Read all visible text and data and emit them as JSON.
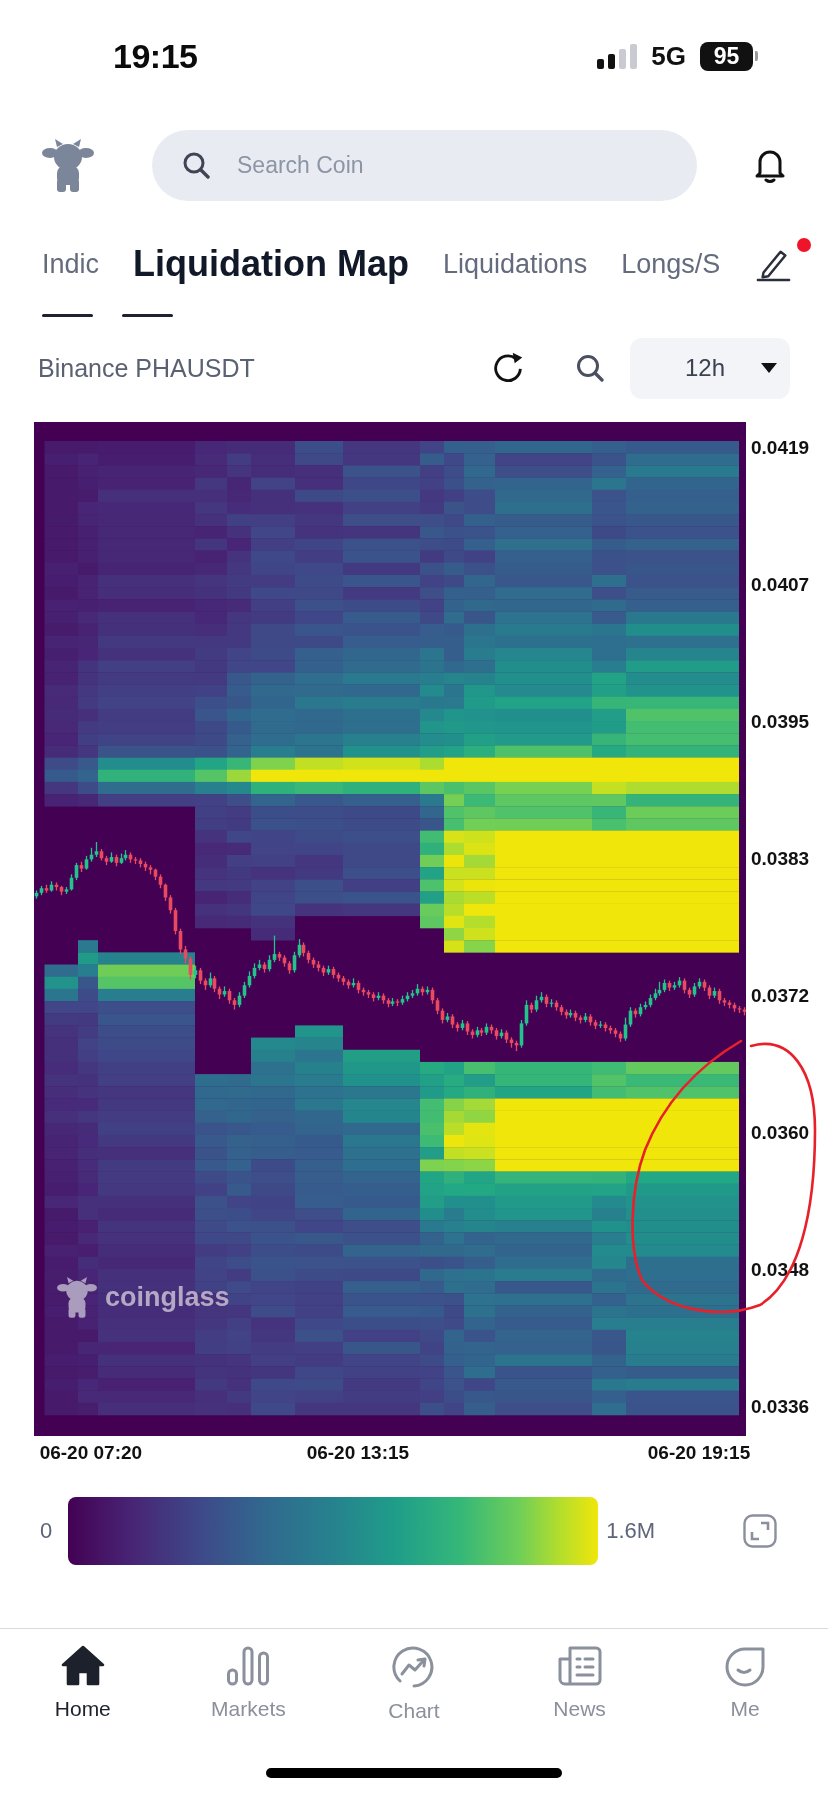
{
  "status_bar": {
    "time": "19:15",
    "network": "5G",
    "battery": "95"
  },
  "header": {
    "search": {
      "placeholder": "Search Coin"
    }
  },
  "tabs": [
    {
      "label": "Indic",
      "selected": false
    },
    {
      "label": "Liquidation Map",
      "selected": true
    },
    {
      "label": "Liquidations",
      "selected": false
    },
    {
      "label": "Longs/S",
      "selected": false
    }
  ],
  "tab_editor": {
    "badge": true
  },
  "toolbar": {
    "pair": "Binance PHAUSDT",
    "interval": "12h"
  },
  "chart": {
    "watermark": "coinglass",
    "chart_data": {
      "type": "candlestick",
      "ylim": [
        0.033349,
        0.042125
      ],
      "yticks": [
        {
          "value": 0.0419,
          "label": "0.0419"
        },
        {
          "value": 0.040714,
          "label": "0.0407"
        },
        {
          "value": 0.039529,
          "label": "0.0395"
        },
        {
          "value": 0.038343,
          "label": "0.0383"
        },
        {
          "value": 0.037157,
          "label": "0.0372"
        },
        {
          "value": 0.035971,
          "label": "0.0360"
        },
        {
          "value": 0.034786,
          "label": "0.0348"
        },
        {
          "value": 0.0336,
          "label": "0.0336"
        }
      ],
      "categories": [
        null,
        null,
        null,
        null,
        null,
        null,
        null,
        null,
        null,
        null,
        null,
        "06-20 07:20",
        null,
        null,
        null,
        null,
        null,
        null,
        null,
        null,
        null,
        null,
        null,
        null,
        null,
        null,
        null,
        null,
        null,
        null,
        null,
        null,
        null,
        null,
        null,
        null,
        null,
        null,
        null,
        null,
        null,
        null,
        null,
        null,
        null,
        null,
        null,
        null,
        null,
        null,
        null,
        null,
        null,
        null,
        null,
        null,
        null,
        null,
        null,
        null,
        null,
        null,
        null,
        null,
        null,
        "06-20 13:15",
        null,
        null,
        null,
        null,
        null,
        null,
        null,
        null,
        null,
        null,
        null,
        null,
        null,
        null,
        null,
        null,
        null,
        null,
        null,
        null,
        null,
        null,
        null,
        null,
        null,
        null,
        null,
        null,
        null,
        null,
        null,
        null,
        null,
        null,
        null,
        null,
        null,
        null,
        null,
        null,
        null,
        null,
        null,
        null,
        null,
        null,
        null,
        null,
        null,
        null,
        null,
        null,
        null,
        null,
        null,
        null,
        null,
        null,
        null,
        null,
        null,
        null,
        null,
        null,
        null,
        null,
        null,
        null,
        "06-20 19:15",
        null,
        null,
        null,
        null,
        null,
        null,
        null,
        null,
        null
      ],
      "ohlc": [
        [
          0.03802,
          0.03807,
          0.038,
          0.03805
        ],
        [
          0.03805,
          0.03811,
          0.03803,
          0.03809
        ],
        [
          0.03809,
          0.03812,
          0.03805,
          0.03807
        ],
        [
          0.03807,
          0.03815,
          0.03806,
          0.03812
        ],
        [
          0.03812,
          0.03814,
          0.03807,
          0.0381
        ],
        [
          0.0381,
          0.03811,
          0.03803,
          0.03806
        ],
        [
          0.03806,
          0.0381,
          0.03804,
          0.03808
        ],
        [
          0.03808,
          0.03821,
          0.03807,
          0.03818
        ],
        [
          0.03818,
          0.03831,
          0.03816,
          0.03829
        ],
        [
          0.03829,
          0.03832,
          0.03823,
          0.03826
        ],
        [
          0.03826,
          0.03837,
          0.03825,
          0.03834
        ],
        [
          0.03834,
          0.03844,
          0.03832,
          0.03838
        ],
        [
          0.03838,
          0.03849,
          0.03836,
          0.03841
        ],
        [
          0.03841,
          0.03843,
          0.03833,
          0.03835
        ],
        [
          0.03835,
          0.03837,
          0.03829,
          0.03832
        ],
        [
          0.03832,
          0.0384,
          0.03831,
          0.03836
        ],
        [
          0.03836,
          0.03838,
          0.03828,
          0.03831
        ],
        [
          0.03831,
          0.03839,
          0.0383,
          0.03835
        ],
        [
          0.03835,
          0.03842,
          0.03833,
          0.03838
        ],
        [
          0.03838,
          0.0384,
          0.03831,
          0.03834
        ],
        [
          0.03834,
          0.03836,
          0.0383,
          0.03833
        ],
        [
          0.03833,
          0.03835,
          0.03827,
          0.0383
        ],
        [
          0.0383,
          0.03832,
          0.03824,
          0.03827
        ],
        [
          0.03827,
          0.03829,
          0.03821,
          0.03825
        ],
        [
          0.03825,
          0.03826,
          0.03816,
          0.03819
        ],
        [
          0.03819,
          0.03821,
          0.03809,
          0.03812
        ],
        [
          0.03812,
          0.03813,
          0.03798,
          0.03801
        ],
        [
          0.03801,
          0.03803,
          0.03787,
          0.0379
        ],
        [
          0.0379,
          0.03792,
          0.03769,
          0.03772
        ],
        [
          0.03772,
          0.03774,
          0.03752,
          0.03756
        ],
        [
          0.03756,
          0.03759,
          0.03744,
          0.03748
        ],
        [
          0.03748,
          0.0375,
          0.0373,
          0.03734
        ],
        [
          0.03734,
          0.03742,
          0.03731,
          0.03738
        ],
        [
          0.03738,
          0.0374,
          0.03726,
          0.03729
        ],
        [
          0.03729,
          0.03731,
          0.03721,
          0.03725
        ],
        [
          0.03725,
          0.03736,
          0.03723,
          0.03731
        ],
        [
          0.03731,
          0.03733,
          0.03719,
          0.03722
        ],
        [
          0.03722,
          0.03724,
          0.03713,
          0.03717
        ],
        [
          0.03717,
          0.03724,
          0.03715,
          0.0372
        ],
        [
          0.0372,
          0.03722,
          0.03709,
          0.03712
        ],
        [
          0.03712,
          0.03714,
          0.03704,
          0.03708
        ],
        [
          0.03708,
          0.03719,
          0.03706,
          0.03716
        ],
        [
          0.03716,
          0.03728,
          0.03714,
          0.03725
        ],
        [
          0.03725,
          0.03737,
          0.03723,
          0.03733
        ],
        [
          0.03733,
          0.03744,
          0.03731,
          0.0374
        ],
        [
          0.0374,
          0.03747,
          0.03738,
          0.03743
        ],
        [
          0.03743,
          0.03745,
          0.03736,
          0.03739
        ],
        [
          0.03739,
          0.03751,
          0.03737,
          0.03747
        ],
        [
          0.03747,
          0.03768,
          0.03745,
          0.03752
        ],
        [
          0.03752,
          0.03754,
          0.03746,
          0.03749
        ],
        [
          0.03749,
          0.03751,
          0.03741,
          0.03744
        ],
        [
          0.03744,
          0.03746,
          0.03735,
          0.03738
        ],
        [
          0.03738,
          0.03754,
          0.03736,
          0.03751
        ],
        [
          0.03751,
          0.03765,
          0.03749,
          0.0376
        ],
        [
          0.0376,
          0.03762,
          0.0375,
          0.03753
        ],
        [
          0.03753,
          0.03755,
          0.03744,
          0.03747
        ],
        [
          0.03747,
          0.03749,
          0.0374,
          0.03743
        ],
        [
          0.03743,
          0.03746,
          0.03737,
          0.0374
        ],
        [
          0.0374,
          0.03742,
          0.03733,
          0.03736
        ],
        [
          0.03736,
          0.03742,
          0.03734,
          0.03739
        ],
        [
          0.03739,
          0.03741,
          0.03731,
          0.03734
        ],
        [
          0.03734,
          0.03736,
          0.03728,
          0.03731
        ],
        [
          0.03731,
          0.03733,
          0.03725,
          0.03728
        ],
        [
          0.03728,
          0.0373,
          0.03722,
          0.03725
        ],
        [
          0.03725,
          0.03731,
          0.03723,
          0.03727
        ],
        [
          0.03727,
          0.03729,
          0.03718,
          0.03721
        ],
        [
          0.03721,
          0.03723,
          0.03716,
          0.03719
        ],
        [
          0.03719,
          0.03721,
          0.03714,
          0.03717
        ],
        [
          0.03717,
          0.03719,
          0.03711,
          0.03714
        ],
        [
          0.03714,
          0.03719,
          0.03712,
          0.03716
        ],
        [
          0.03716,
          0.03718,
          0.03709,
          0.03712
        ],
        [
          0.03712,
          0.03714,
          0.03706,
          0.03709
        ],
        [
          0.03709,
          0.03714,
          0.03707,
          0.03711
        ],
        [
          0.03711,
          0.03713,
          0.03707,
          0.0371
        ],
        [
          0.0371,
          0.03716,
          0.03708,
          0.03713
        ],
        [
          0.03713,
          0.03719,
          0.03711,
          0.03716
        ],
        [
          0.03716,
          0.03721,
          0.03714,
          0.03718
        ],
        [
          0.03718,
          0.03726,
          0.03716,
          0.03722
        ],
        [
          0.03722,
          0.03724,
          0.03716,
          0.03719
        ],
        [
          0.03719,
          0.03724,
          0.03717,
          0.03721
        ],
        [
          0.03721,
          0.03723,
          0.03709,
          0.03712
        ],
        [
          0.03712,
          0.03714,
          0.037,
          0.03703
        ],
        [
          0.03703,
          0.03705,
          0.03692,
          0.03695
        ],
        [
          0.03695,
          0.03701,
          0.03693,
          0.03698
        ],
        [
          0.03698,
          0.037,
          0.03688,
          0.03691
        ],
        [
          0.03691,
          0.03693,
          0.03685,
          0.03688
        ],
        [
          0.03688,
          0.03695,
          0.03686,
          0.03692
        ],
        [
          0.03692,
          0.03694,
          0.03682,
          0.03685
        ],
        [
          0.03685,
          0.03687,
          0.03679,
          0.03682
        ],
        [
          0.03682,
          0.03689,
          0.0368,
          0.03686
        ],
        [
          0.03686,
          0.03688,
          0.03681,
          0.03684
        ],
        [
          0.03684,
          0.03692,
          0.03682,
          0.03689
        ],
        [
          0.03689,
          0.03691,
          0.03683,
          0.03686
        ],
        [
          0.03686,
          0.03688,
          0.03678,
          0.03681
        ],
        [
          0.03681,
          0.03687,
          0.03679,
          0.03684
        ],
        [
          0.03684,
          0.03686,
          0.03675,
          0.03678
        ],
        [
          0.03678,
          0.0368,
          0.03671,
          0.03675
        ],
        [
          0.03675,
          0.03677,
          0.03668,
          0.03673
        ],
        [
          0.03673,
          0.03695,
          0.03671,
          0.03692
        ],
        [
          0.03692,
          0.03712,
          0.0369,
          0.03708
        ],
        [
          0.03708,
          0.0371,
          0.03701,
          0.03704
        ],
        [
          0.03704,
          0.03716,
          0.03702,
          0.03712
        ],
        [
          0.03712,
          0.03719,
          0.0371,
          0.03715
        ],
        [
          0.03715,
          0.03717,
          0.03706,
          0.03709
        ],
        [
          0.03709,
          0.03713,
          0.03706,
          0.0371
        ],
        [
          0.0371,
          0.03712,
          0.03703,
          0.03706
        ],
        [
          0.03706,
          0.03708,
          0.03699,
          0.03702
        ],
        [
          0.03702,
          0.03704,
          0.03696,
          0.03699
        ],
        [
          0.03699,
          0.03704,
          0.03697,
          0.03701
        ],
        [
          0.03701,
          0.03703,
          0.03694,
          0.03697
        ],
        [
          0.03697,
          0.03699,
          0.03692,
          0.03695
        ],
        [
          0.03695,
          0.03701,
          0.03693,
          0.03698
        ],
        [
          0.03698,
          0.037,
          0.0369,
          0.03693
        ],
        [
          0.03693,
          0.03695,
          0.03687,
          0.0369
        ],
        [
          0.0369,
          0.03694,
          0.03688,
          0.03691
        ],
        [
          0.03691,
          0.03693,
          0.03685,
          0.03688
        ],
        [
          0.03688,
          0.0369,
          0.03683,
          0.03686
        ],
        [
          0.03686,
          0.03688,
          0.0368,
          0.03683
        ],
        [
          0.03683,
          0.03685,
          0.03676,
          0.03679
        ],
        [
          0.03679,
          0.03697,
          0.03677,
          0.03691
        ],
        [
          0.03691,
          0.03706,
          0.03689,
          0.03703
        ],
        [
          0.03703,
          0.03705,
          0.03697,
          0.037
        ],
        [
          0.037,
          0.03709,
          0.03698,
          0.03706
        ],
        [
          0.03706,
          0.03711,
          0.03704,
          0.03708
        ],
        [
          0.03708,
          0.03717,
          0.03706,
          0.03714
        ],
        [
          0.03714,
          0.03722,
          0.03712,
          0.03718
        ],
        [
          0.03718,
          0.03728,
          0.03716,
          0.03721
        ],
        [
          0.03721,
          0.0373,
          0.03719,
          0.03727
        ],
        [
          0.03727,
          0.03729,
          0.0372,
          0.03723
        ],
        [
          0.03723,
          0.03728,
          0.03721,
          0.03725
        ],
        [
          0.03725,
          0.03732,
          0.03723,
          0.03729
        ],
        [
          0.03729,
          0.03731,
          0.03718,
          0.03721
        ],
        [
          0.03721,
          0.03723,
          0.03714,
          0.03717
        ],
        [
          0.03717,
          0.03727,
          0.03715,
          0.03724
        ],
        [
          0.03724,
          0.03731,
          0.03722,
          0.03728
        ],
        [
          0.03728,
          0.0373,
          0.0372,
          0.03723
        ],
        [
          0.03723,
          0.03725,
          0.03713,
          0.03716
        ],
        [
          0.03716,
          0.03723,
          0.03714,
          0.0372
        ],
        [
          0.0372,
          0.03722,
          0.03709,
          0.03712
        ],
        [
          0.03712,
          0.03714,
          0.03707,
          0.0371
        ],
        [
          0.0371,
          0.03712,
          0.03705,
          0.03708
        ],
        [
          0.03708,
          0.0371,
          0.03702,
          0.03705
        ],
        [
          0.03705,
          0.03707,
          0.03701,
          0.03704
        ],
        [
          0.03704,
          0.03706,
          0.03699,
          0.03702
        ]
      ]
    }
  },
  "legend": {
    "min": "0",
    "max": "1.6M"
  },
  "nav": [
    {
      "kind": "home",
      "label": "Home",
      "selected": true
    },
    {
      "kind": "markets",
      "label": "Markets",
      "selected": false
    },
    {
      "kind": "chart",
      "label": "Chart",
      "selected": false
    },
    {
      "kind": "news",
      "label": "News",
      "selected": false
    },
    {
      "kind": "me",
      "label": "Me",
      "selected": false
    }
  ]
}
